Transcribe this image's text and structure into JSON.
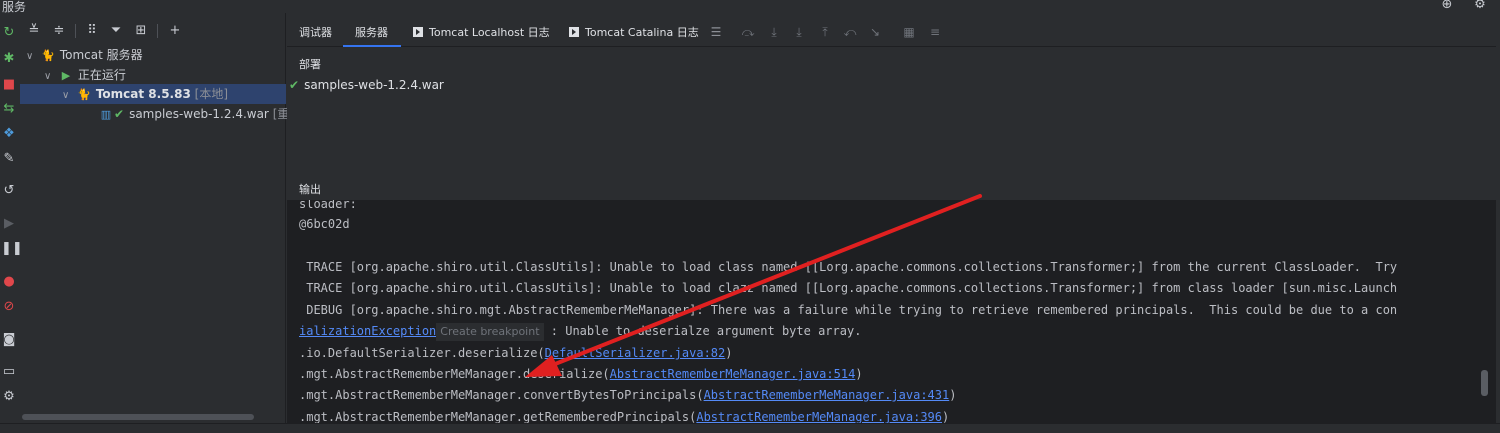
{
  "window": {
    "title": "服务"
  },
  "tree": {
    "root_label": "Tomcat 服务器",
    "running_label": "正在运行",
    "server_name": "Tomcat 8.5.83",
    "server_tag": "[本地]",
    "artifact_label": "samples-web-1.2.4.war",
    "artifact_status": "[重新"
  },
  "tabs": [
    {
      "label": "调试器"
    },
    {
      "label": "服务器"
    },
    {
      "label": "Tomcat Localhost 日志"
    },
    {
      "label": "Tomcat Catalina 日志"
    }
  ],
  "deploy": {
    "section_label": "部署",
    "item_label": "samples-web-1.2.4.war"
  },
  "output": {
    "section_label": "输出",
    "lines": [
      {
        "text": "sloader:"
      },
      {
        "text": "@6bc02d"
      },
      {
        "text": ""
      },
      {
        "text": " TRACE [org.apache.shiro.util.ClassUtils]: Unable to load class named [[Lorg.apache.commons.collections.Transformer;] from the current ClassLoader.  Try"
      },
      {
        "text": " TRACE [org.apache.shiro.util.ClassUtils]: Unable to load clazz named [[Lorg.apache.commons.collections.Transformer;] from class loader [sun.misc.Launch"
      },
      {
        "text": " DEBUG [org.apache.shiro.mgt.AbstractRememberMeManager]: There was a failure while trying to retrieve remembered principals.  This could be due to a con"
      }
    ],
    "exception_link": "ializationException",
    "tooltip": "Create breakpoint",
    "exception_rest": ": Unable to deserialze argument byte array.",
    "stack": [
      {
        "prefix": ".io.DefaultSerializer.deserialize(",
        "link": "DefaultSerializer.java:82",
        "suffix": ")"
      },
      {
        "prefix": ".mgt.AbstractRememberMeManager.deserialize(",
        "link": "AbstractRememberMeManager.java:514",
        "suffix": ")"
      },
      {
        "prefix": ".mgt.AbstractRememberMeManager.convertBytesToPrincipals(",
        "link": "AbstractRememberMeManager.java:431",
        "suffix": ")"
      },
      {
        "prefix": ".mgt.AbstractRememberMeManager.getRememberedPrincipals(",
        "link": "AbstractRememberMeManager.java:396",
        "suffix": ")"
      }
    ]
  },
  "colors": {
    "accent": "#3574f0",
    "selection": "#2e436e",
    "link": "#548af7",
    "check": "#5fb865",
    "annotation_arrow": "#e02020"
  }
}
